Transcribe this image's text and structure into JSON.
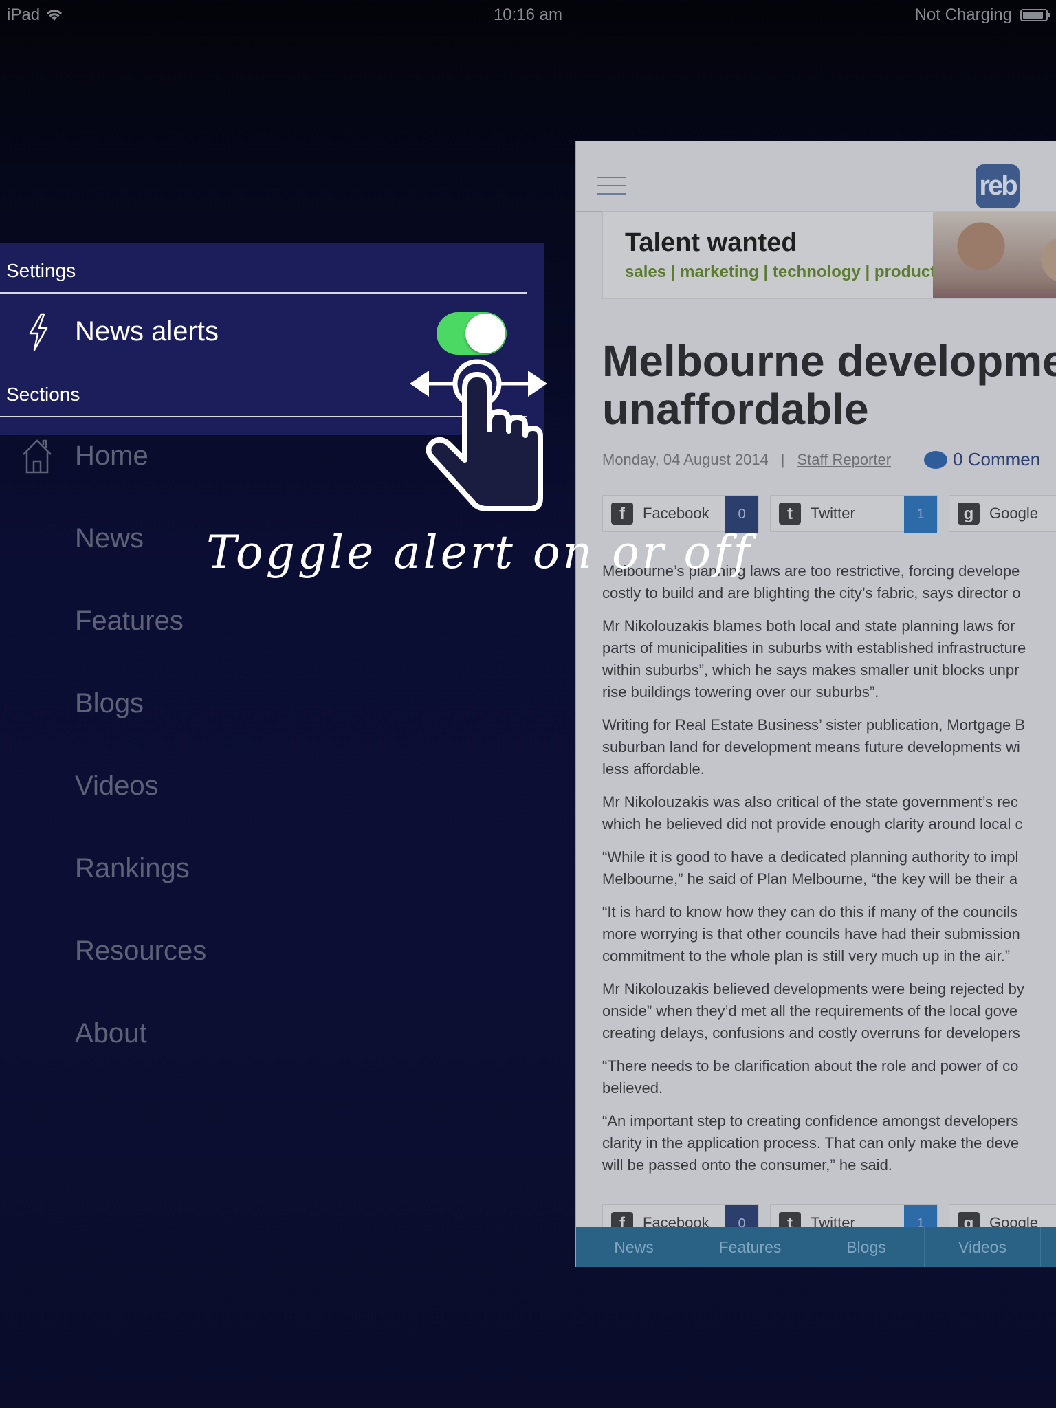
{
  "status_bar": {
    "device": "iPad",
    "time": "10:16 am",
    "battery_text": "Not Charging",
    "battery_level": 0.9
  },
  "settings": {
    "section_title": "Settings",
    "news_alerts_label": "News alerts",
    "news_alerts_on": true,
    "sections_title": "Sections"
  },
  "menu": {
    "items": [
      {
        "label": "Home"
      },
      {
        "label": "News"
      },
      {
        "label": "Features"
      },
      {
        "label": "Blogs"
      },
      {
        "label": "Videos"
      },
      {
        "label": "Rankings"
      },
      {
        "label": "Resources"
      },
      {
        "label": "About"
      }
    ]
  },
  "hint": {
    "text": "Toggle alert on or off"
  },
  "article": {
    "logo_text": "reb",
    "ad": {
      "title": "Talent wanted",
      "subtitle": "sales | marketing | technology | product"
    },
    "headline_line1": "Melbourne developme",
    "headline_line2": "unaffordable",
    "date": "Monday, 04 August 2014",
    "separator": "|",
    "author": "Staff Reporter",
    "comments": "0 Commen",
    "share": {
      "facebook_label": "Facebook",
      "facebook_count": "0",
      "twitter_label": "Twitter",
      "twitter_count": "1",
      "google_label": "Google"
    },
    "paragraphs": [
      "Melbourne’s planning laws are too restrictive, forcing develope",
      "costly to build and are blighting the city’s fabric, says director o",
      "Mr Nikolouzakis blames both local and state planning laws for",
      "parts of municipalities in suburbs with established infrastructure",
      "within suburbs”, which he says makes smaller unit blocks unpr",
      "rise buildings towering over our suburbs”.",
      "Writing for Real Estate Business’ sister publication, Mortgage B",
      "suburban land for development means future developments wi",
      "less affordable.",
      "Mr Nikolouzakis was also critical of the state government’s rec",
      "which he believed did not provide enough clarity around local c",
      "“While it is good to have a dedicated planning authority to impl",
      "Melbourne,” he said of Plan Melbourne, “the key will be their a",
      "“It is hard to know how they can do this if many of the councils",
      "more worrying is that other councils have had their submission",
      "commitment to the whole plan is still very much up in the air.”",
      "Mr Nikolouzakis believed developments were being rejected by",
      "onside” when they’d met all the requirements of the local gove",
      "creating delays, confusions and costly overruns for developers",
      "“There needs to be clarification about the role and power of co",
      "believed.",
      "“An important step to creating confidence amongst developers",
      "clarity in the application process. That can only make the deve",
      "will be passed onto the consumer,” he said."
    ],
    "tabs": [
      "News",
      "Features",
      "Blogs",
      "Videos"
    ]
  }
}
